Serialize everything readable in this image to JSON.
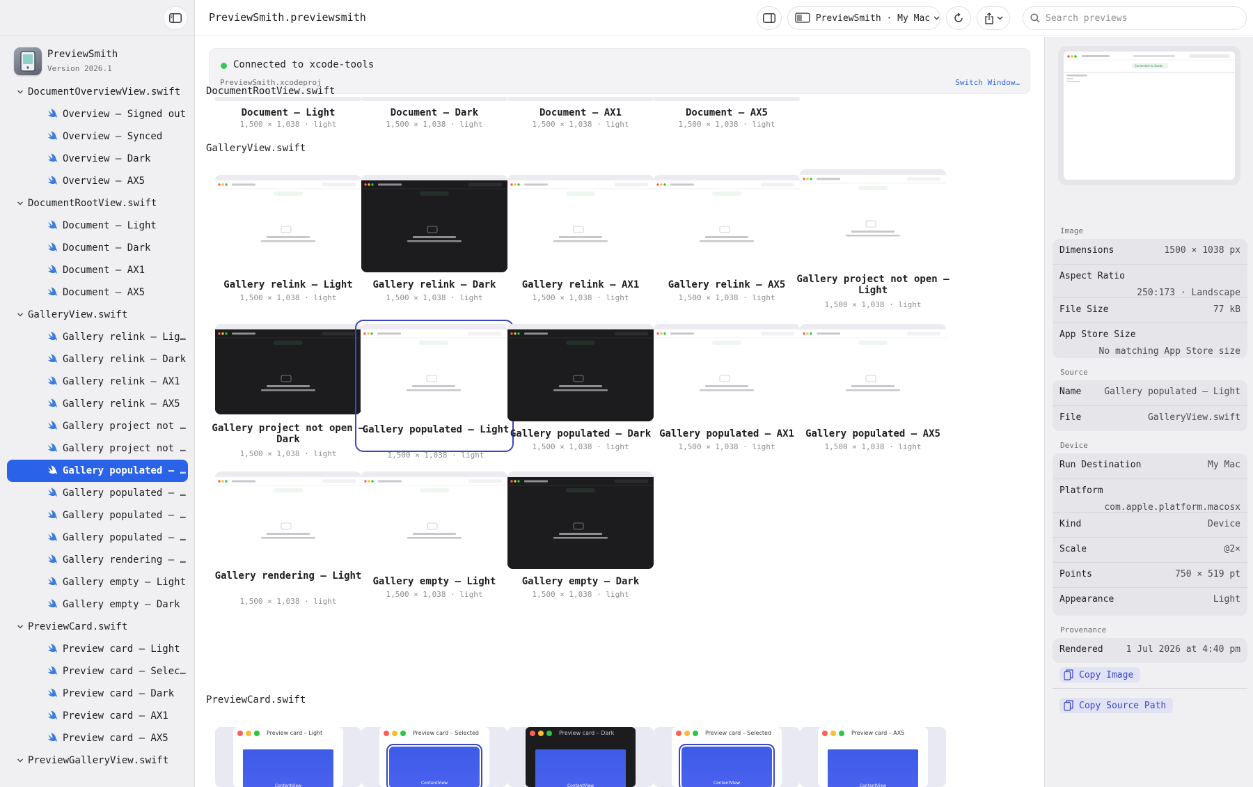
{
  "app": {
    "name": "PreviewSmith",
    "version": "Version 2026.1"
  },
  "toolbar": {
    "title": "PreviewSmith.previewsmith",
    "destination": "PreviewSmith · My Mac",
    "search_placeholder": "Search previews"
  },
  "sidebar": {
    "groups": [
      {
        "file": "DocumentOverviewView.swift",
        "items": [
          "Overview — Signed out",
          "Overview — Synced",
          "Overview — Dark",
          "Overview — AX5"
        ]
      },
      {
        "file": "DocumentRootView.swift",
        "items": [
          "Document — Light",
          "Document — Dark",
          "Document — AX1",
          "Document — AX5"
        ]
      },
      {
        "file": "GalleryView.swift",
        "items": [
          "Gallery relink — Light",
          "Gallery relink — Dark",
          "Gallery relink — AX1",
          "Gallery relink — AX5",
          "Gallery project not op…",
          "Gallery project not op…",
          "Gallery populated — Li…",
          "Gallery populated — Da…",
          "Gallery populated — AX1",
          "Gallery populated — AX5",
          "Gallery rendering — Li…",
          "Gallery empty — Light",
          "Gallery empty — Dark"
        ]
      },
      {
        "file": "PreviewCard.swift",
        "items": [
          "Preview card — Light",
          "Preview card — Selected",
          "Preview card — Dark",
          "Preview card — AX1",
          "Preview card — AX5"
        ]
      },
      {
        "file": "PreviewGalleryView.swift",
        "items": []
      }
    ],
    "selected": "Gallery populated — Li…"
  },
  "banner": {
    "status": "Connected to xcode-tools",
    "project": "PreviewSmith.xcodeproj",
    "switch_label": "Switch Window…",
    "status_color": "#34c759"
  },
  "sections": {
    "doc_root": {
      "title": "DocumentRootView.swift",
      "cards": [
        {
          "title": "Document — Light",
          "meta": "1,500 × 1,038 · light"
        },
        {
          "title": "Document — Dark",
          "meta": "1,500 × 1,038 · light"
        },
        {
          "title": "Document — AX1",
          "meta": "1,500 × 1,038 · light"
        },
        {
          "title": "Document — AX5",
          "meta": "1,500 × 1,038 · light"
        }
      ]
    },
    "gallery": {
      "title": "GalleryView.swift",
      "rows": [
        [
          {
            "title": "Gallery relink — Light",
            "meta": "1,500 × 1,038 · light",
            "theme": "light"
          },
          {
            "title": "Gallery relink — Dark",
            "meta": "1,500 × 1,038 · light",
            "theme": "dark"
          },
          {
            "title": "Gallery relink — AX1",
            "meta": "1,500 × 1,038 · light",
            "theme": "light"
          },
          {
            "title": "Gallery relink — AX5",
            "meta": "1,500 × 1,038 · light",
            "theme": "light"
          },
          {
            "title": "Gallery project not open — Light",
            "meta": "1,500 × 1,038 · light",
            "theme": "light"
          }
        ],
        [
          {
            "title": "Gallery project not open — Dark",
            "meta": "1,500 × 1,038 · light",
            "theme": "dark"
          },
          {
            "title": "Gallery populated — Light",
            "meta": "1,500 × 1,038 · light",
            "theme": "light",
            "selected": true
          },
          {
            "title": "Gallery populated — Dark",
            "meta": "1,500 × 1,038 · light",
            "theme": "dark"
          },
          {
            "title": "Gallery populated — AX1",
            "meta": "1,500 × 1,038 · light",
            "theme": "light"
          },
          {
            "title": "Gallery populated — AX5",
            "meta": "1,500 × 1,038 · light",
            "theme": "light"
          }
        ],
        [
          {
            "title": "Gallery rendering — Light",
            "meta": "1,500 × 1,038 · light",
            "theme": "light"
          },
          {
            "title": "Gallery empty — Light",
            "meta": "1,500 × 1,038 · light",
            "theme": "light"
          },
          {
            "title": "Gallery empty — Dark",
            "meta": "1,500 × 1,038 · light",
            "theme": "dark"
          }
        ]
      ]
    },
    "preview_card": {
      "title": "PreviewCard.swift",
      "cards": [
        {
          "label": "Preview card – Light",
          "theme": "light"
        },
        {
          "label": "Preview card – Selected",
          "theme": "light"
        },
        {
          "label": "Preview card – Dark",
          "theme": "dark"
        },
        {
          "label": "Preview card – Selected",
          "theme": "light"
        },
        {
          "label": "Preview card – AX5",
          "theme": "light"
        }
      ],
      "content_label": "ContentView"
    }
  },
  "inspector": {
    "image_label": "Image",
    "image_rows": [
      {
        "k": "Dimensions",
        "v": "1500 × 1038 px"
      },
      {
        "k": "Aspect Ratio",
        "v": "250:173 · Landscape"
      },
      {
        "k": "File Size",
        "v": "77 kB"
      },
      {
        "k": "App Store Size",
        "v": "No matching App Store size"
      }
    ],
    "source_label": "Source",
    "source_rows": [
      {
        "k": "Name",
        "v": "Gallery populated — Light"
      },
      {
        "k": "File",
        "v": "GalleryView.swift"
      }
    ],
    "device_label": "Device",
    "device_rows": [
      {
        "k": "Run Destination",
        "v": "My Mac"
      },
      {
        "k": "Platform",
        "v": "com.apple.platform.macosx"
      },
      {
        "k": "Kind",
        "v": "Device"
      },
      {
        "k": "Scale",
        "v": "@2×"
      },
      {
        "k": "Points",
        "v": "750 × 519 pt"
      },
      {
        "k": "Appearance",
        "v": "Light"
      }
    ],
    "provenance_label": "Provenance",
    "provenance_rows": [
      {
        "k": "Rendered",
        "v": "1 Jul 2026 at 4:40 pm"
      }
    ],
    "copy_image": "Copy Image",
    "copy_source_path": "Copy Source Path",
    "preview_status": "Connected to Xcode"
  },
  "colors": {
    "accent": "#2a62e8",
    "selection_border": "#3b46c6",
    "action_text": "#3b46c6"
  }
}
